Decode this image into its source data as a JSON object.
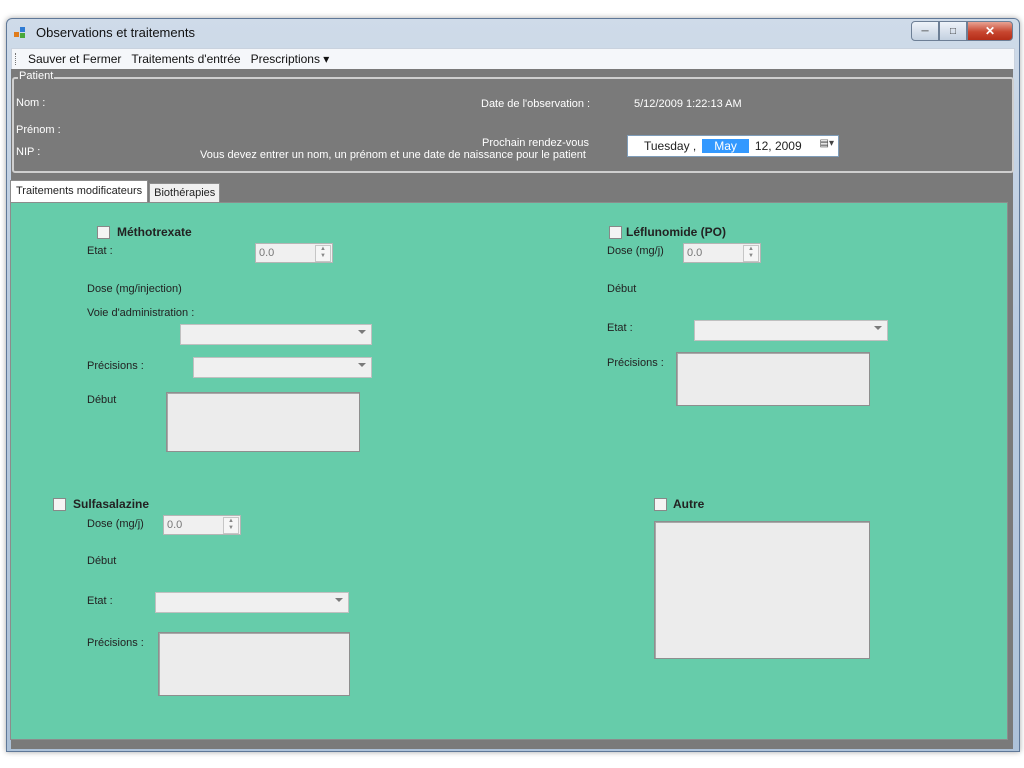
{
  "window": {
    "title": "Observations et traitements"
  },
  "menu": [
    "Sauver et Fermer",
    "Traitements d'entrée",
    "Prescriptions  ▾"
  ],
  "patient": {
    "group_title": "Patient",
    "nom_label": "Nom :",
    "prenom_label": "Prénom :",
    "nip_label": "NIP :",
    "date_obs_label": "Date de l'observation :",
    "date_obs_value": "5/12/2009 1:22:13 AM",
    "rdv_label": "Prochain rendez-vous",
    "warning": "Vous devez entrer un nom, un prénom et une date de naissance pour le patient",
    "date_day": "Tuesday  ,",
    "date_month": "May",
    "date_rest": "12, 2009"
  },
  "tabs": [
    "Traitements modificateurs",
    "Biothérapies"
  ],
  "methotrexate": {
    "title": "Méthotrexate",
    "etat_label": "Etat :",
    "etat_value": "0.0",
    "dose_label": "Dose (mg/injection)",
    "voie_label": "Voie d'administration :",
    "precisions_label": "Précisions :",
    "debut_label": "Début"
  },
  "leflunomide": {
    "title": "Léflunomide (PO)",
    "dose_label": "Dose (mg/j)",
    "dose_value": "0.0",
    "debut_label": "Début",
    "etat_label": "Etat :",
    "precisions_label": "Précisions :"
  },
  "sulfasalazine": {
    "title": "Sulfasalazine",
    "dose_label": "Dose (mg/j)",
    "dose_value": "0.0",
    "debut_label": "Début",
    "etat_label": "Etat :",
    "precisions_label": "Précisions :"
  },
  "autre": {
    "title": "Autre"
  },
  "icons": {
    "app": "app-icon",
    "minimize": "minimize-icon",
    "maximize": "maximize-icon",
    "close": "close-icon",
    "calendar": "calendar-icon",
    "dropdown": "chevron-down-icon"
  },
  "colors": {
    "panel_bg": "#66ccaa",
    "patient_bg": "#7a7a7a",
    "selection": "#3399ff",
    "close_button": "#c7462f"
  }
}
